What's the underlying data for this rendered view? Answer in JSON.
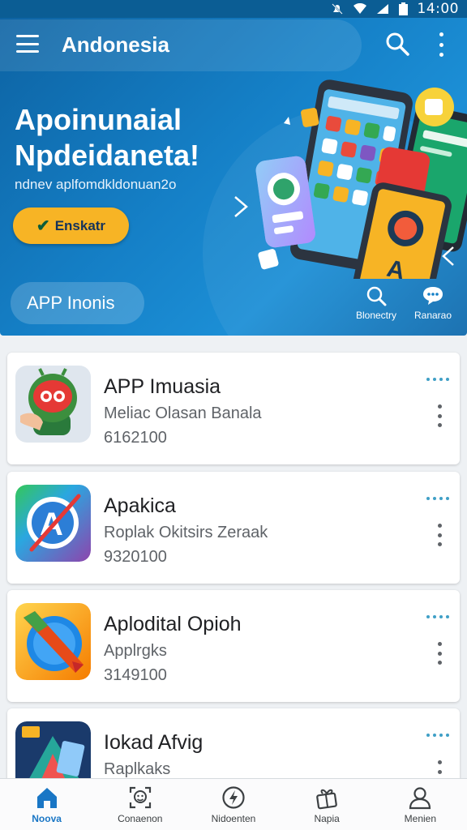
{
  "status_bar": {
    "time": "14:00"
  },
  "app": {
    "title": "Andonesia"
  },
  "hero": {
    "title": "Apoinunaial Npdeidaneta!",
    "subtitle": "ndnev aplfomdkldonuan2o",
    "cta_label": "Enskatr"
  },
  "toolbar": {
    "category_label": "APP Inonis",
    "actions": [
      {
        "label": "Blonectry",
        "icon": "search-icon"
      },
      {
        "label": "Ranarao",
        "icon": "chat-icon"
      }
    ]
  },
  "apps": [
    {
      "name": "APP Imuasia",
      "subtitle": "Meliac Olasan Banala",
      "meta": "6162100",
      "icon": "robot-app-icon"
    },
    {
      "name": "Apakica",
      "subtitle": "Roplak Okitsirs Zeraak",
      "meta": "9320100",
      "icon": "compass-app-icon"
    },
    {
      "name": "Aplodital Opioh",
      "subtitle": "Applrgks",
      "meta": "3149100",
      "icon": "knife-app-icon"
    },
    {
      "name": "Iokad Afvig",
      "subtitle": "Raplkaks",
      "meta": "",
      "icon": "cards-app-icon"
    }
  ],
  "bottom_nav": [
    {
      "label": "Noova",
      "icon": "home-icon",
      "active": true
    },
    {
      "label": "Conaenon",
      "icon": "face-frame-icon",
      "active": false
    },
    {
      "label": "Nidoenten",
      "icon": "bolt-icon",
      "active": false
    },
    {
      "label": "Napia",
      "icon": "gift-icon",
      "active": false
    },
    {
      "label": "Menien",
      "icon": "person-icon",
      "active": false
    }
  ],
  "colors": {
    "primary": "#1580c7",
    "header_dark": "#0d63a3",
    "accent_yellow": "#f7b425",
    "active_nav": "#1976c5"
  }
}
